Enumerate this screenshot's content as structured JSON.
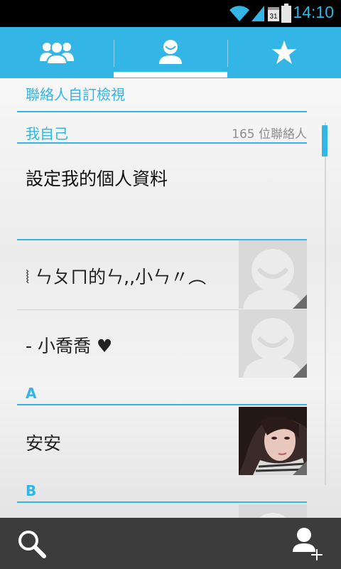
{
  "status_bar": {
    "time": "14:10",
    "calendar_day": "31",
    "icons": [
      "wifi-icon",
      "signal-icon",
      "calendar-icon",
      "battery-icon"
    ],
    "accent": "#33b5e5"
  },
  "tabs": [
    {
      "name": "groups",
      "icon": "groups-icon",
      "selected": false
    },
    {
      "name": "all-contacts",
      "icon": "person-icon",
      "selected": true
    },
    {
      "name": "favorites",
      "icon": "star-icon",
      "selected": false
    }
  ],
  "list": {
    "custom_view_label": "聯絡人自訂檢視",
    "me_label": "我自己",
    "contact_count": "165 位聯絡人",
    "profile_text": "設定我的個人資料",
    "contacts_top": [
      {
        "name": "⦚ ㄣㄆㄇ的ㄣ,,小ㄣ〃︵",
        "avatar": "default-avatar"
      },
      {
        "name": "- 小喬喬 ♥",
        "avatar": "default-avatar"
      }
    ],
    "section_a": "A",
    "contacts_a": [
      {
        "name": "安安",
        "avatar": "photo-avatar"
      }
    ],
    "section_b": "B"
  },
  "bottom_bar": {
    "search_icon": "search-icon",
    "add_contact_icon": "add-contact-icon"
  },
  "colors": {
    "accent": "#33b5e5",
    "tab_bar": "#33b5e5",
    "bottom_bar": "#3c3c3c"
  }
}
